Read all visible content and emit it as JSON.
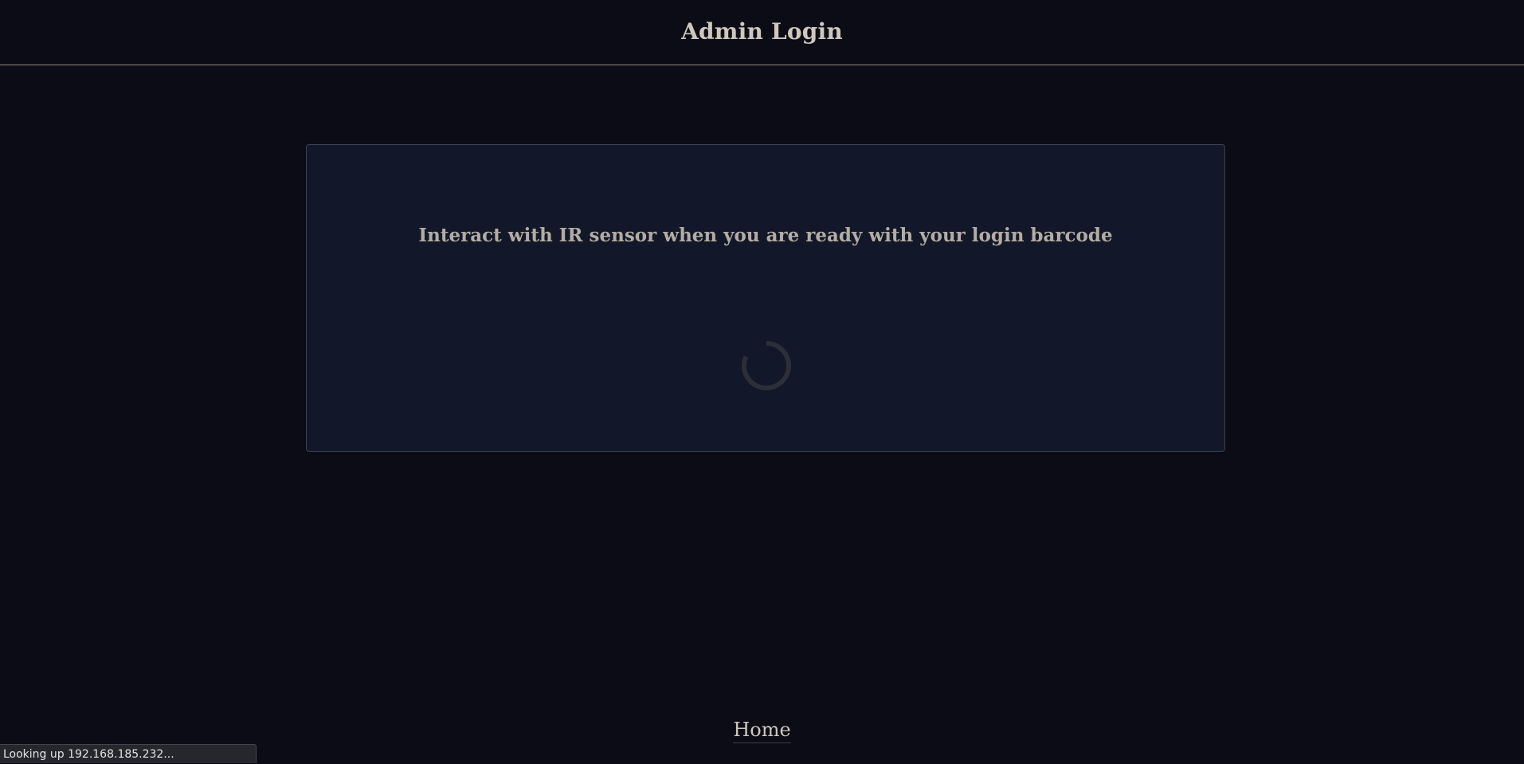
{
  "header": {
    "title": "Admin Login"
  },
  "card": {
    "prompt": "Interact with IR sensor when you are ready with your login barcode",
    "spinner_icon": "loading-spinner-icon"
  },
  "footer": {
    "home_label": "Home"
  },
  "status_bar": {
    "text": "Looking up 192.168.185.232..."
  },
  "colors": {
    "background": "#0b0c16",
    "card_background": "#121729",
    "text": "#c9c2b8"
  }
}
